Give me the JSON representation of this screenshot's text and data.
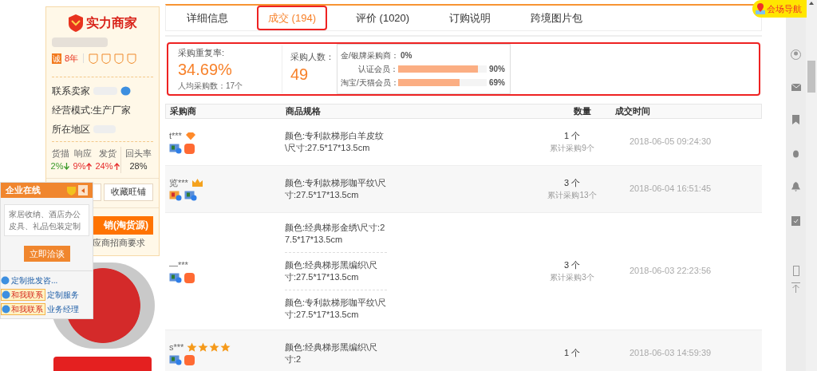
{
  "store": {
    "badge_title": "实力商家",
    "years_icon": "诚",
    "years": "8年",
    "contact_label": "联系卖家",
    "mode": "经营模式:生产厂家",
    "region_label": "所在地区",
    "metrics": [
      {
        "label": "货描",
        "value": "2%",
        "kind": "down"
      },
      {
        "label": "响应",
        "value": "9%",
        "kind": "up"
      },
      {
        "label": "发货",
        "value": "24%",
        "kind": "up"
      },
      {
        "label": "回头率",
        "value": "28%",
        "kind": "flat"
      }
    ],
    "favorite_button": "收藏旺铺",
    "supply_button": "销(淘货源)",
    "supply_link": "应商招商要求"
  },
  "chat_panel": {
    "title": "企业在线",
    "message": "家居收纳、酒店办公皮具、礼品包装定制",
    "action": "立即洽谈",
    "contacts": [
      {
        "kind": "link",
        "label": "定制批发咨..."
      },
      {
        "kind": "contact",
        "button": "和我联系",
        "label": "定制服务"
      },
      {
        "kind": "contact",
        "button": "和我联系",
        "label": "业务经理"
      }
    ]
  },
  "tabs": [
    {
      "label": "详细信息",
      "selected": false
    },
    {
      "label": "成交 (194)",
      "selected": true
    },
    {
      "label": "评价 (1020)",
      "selected": false
    },
    {
      "label": "订购说明",
      "selected": false
    },
    {
      "label": "跨境图片包",
      "selected": false
    }
  ],
  "stats": {
    "repeat_label": "采购重复率:",
    "repeat_value": "34.69%",
    "avg": "人均采购数：17个",
    "buyers_label": "采购人数：",
    "buyers_value": "49",
    "breakdown": [
      {
        "label": "金/银牌采购商：",
        "value": "0%"
      },
      {
        "label": "认证会员：",
        "value": "90%",
        "level": 0.9
      },
      {
        "label": "淘宝/天猫会员：",
        "value": "69%",
        "level": 0.69
      }
    ]
  },
  "table": {
    "columns": [
      "采购商",
      "商品规格",
      "数量",
      "成交时间"
    ],
    "rows": [
      {
        "buyer": "t***",
        "rank": {
          "kind": "diamond"
        },
        "badges": [
          {
            "kind": "id"
          },
          {
            "kind": "taobao"
          }
        ],
        "specs": [
          "颜色:专利款梯形白羊皮纹\\尺寸:27.5*17*13.5cm"
        ],
        "quantity": "1 个",
        "total": "累计采购9个",
        "time": "2018-06-05 09:24:30"
      },
      {
        "buyer": "览***",
        "rank": {
          "kind": "crown"
        },
        "badges": [
          {
            "kind": "gold"
          },
          {
            "kind": "id"
          }
        ],
        "specs": [
          "颜色:专利款梯形咖平纹\\尺寸:27.5*17*13.5cm"
        ],
        "quantity": "3 个",
        "total": "累计采购13个",
        "time": "2018-06-04 16:51:45"
      },
      {
        "buyer": "—***",
        "badges": [
          {
            "kind": "id"
          },
          {
            "kind": "taobao"
          }
        ],
        "specs": [
          "颜色:经典梯形金绣\\尺寸:27.5*17*13.5cm",
          "颜色:经典梯形黑编织\\尺寸:27.5*17*13.5cm",
          "颜色:专利款梯形咖平纹\\尺寸:27.5*17*13.5cm"
        ],
        "quantity": "3 个",
        "total": "累计采购3个",
        "time": "2018-06-03 22:23:56"
      },
      {
        "buyer": "s***",
        "rank": {
          "kind": "star",
          "stars": 4
        },
        "badges": [
          {
            "kind": "id"
          },
          {
            "kind": "taobao"
          }
        ],
        "specs": [
          "颜色:经典梯形黑编织\\尺寸:2"
        ],
        "quantity": "1 个",
        "time": "2018-06-03 14:59:39"
      }
    ]
  },
  "nav_badge": "会场导航"
}
